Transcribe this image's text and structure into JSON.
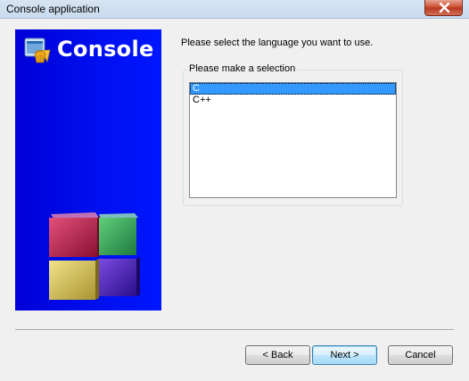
{
  "window": {
    "title": "Console application"
  },
  "banner": {
    "title": "Console",
    "background_color": "#0010f0",
    "logo_icon": "codeblocks-logo-icon",
    "graphic": "colored-cubes-graphic"
  },
  "main": {
    "prompt": "Please select the language you want to use.",
    "group_label": "Please make a selection",
    "languages": [
      {
        "label": "C",
        "selected": true
      },
      {
        "label": "C++",
        "selected": false
      }
    ]
  },
  "buttons": {
    "back": "< Back",
    "next": "Next >",
    "cancel": "Cancel"
  },
  "colors": {
    "selection": "#3399ff",
    "close_button": "#c9492b"
  }
}
